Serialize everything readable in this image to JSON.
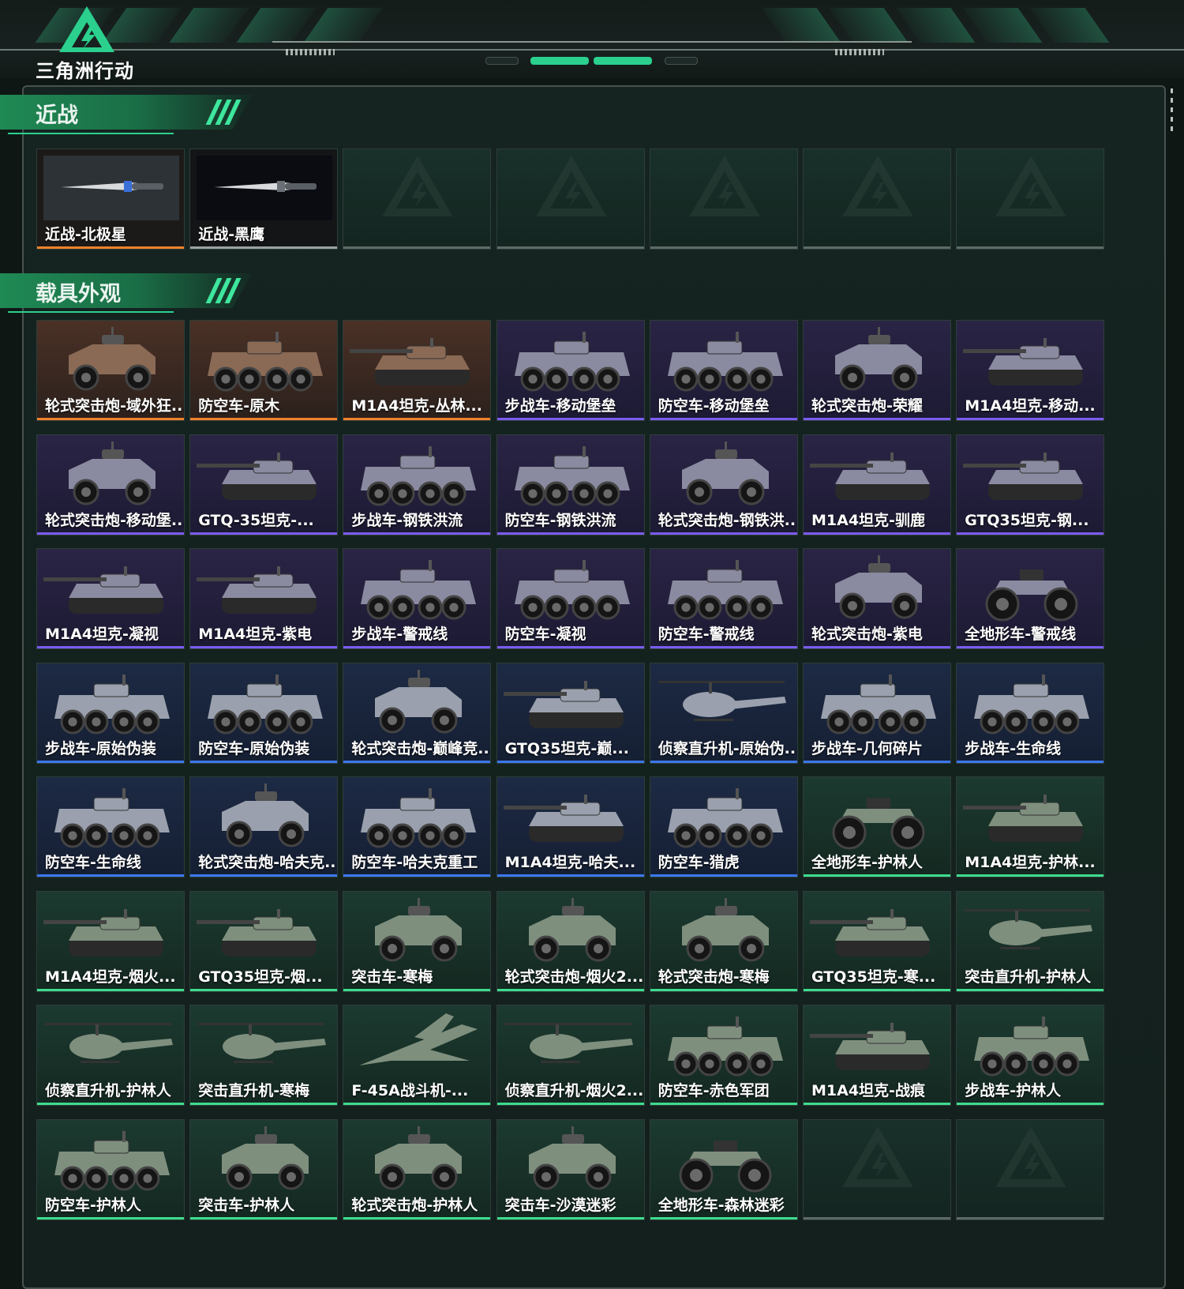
{
  "brand": {
    "name": "三角洲行动",
    "logo_icon": "delta-triangle-logo-icon"
  },
  "colors": {
    "accent": "#2bd08e",
    "orange": "#f0822a",
    "purple": "#7a5cf0",
    "blue": "#3b78f0",
    "green": "#3ddc8e"
  },
  "sections": [
    {
      "title": "近战",
      "items": [
        {
          "label": "近战-北极星",
          "rarity": "orange",
          "type": "knife"
        },
        {
          "label": "近战-黑鹰",
          "rarity": "knife2",
          "type": "knife"
        },
        {
          "label": "",
          "rarity": "empty",
          "type": "empty"
        },
        {
          "label": "",
          "rarity": "empty",
          "type": "empty"
        },
        {
          "label": "",
          "rarity": "empty",
          "type": "empty"
        },
        {
          "label": "",
          "rarity": "empty",
          "type": "empty"
        },
        {
          "label": "",
          "rarity": "empty",
          "type": "empty"
        }
      ]
    },
    {
      "title": "载具外观",
      "items": [
        {
          "label": "轮式突击炮-域外狂...",
          "rarity": "orange",
          "type": "car"
        },
        {
          "label": "防空车-原木",
          "rarity": "orange",
          "type": "apc"
        },
        {
          "label": "M1A4坦克-丛林...",
          "rarity": "orange",
          "type": "tank"
        },
        {
          "label": "步战车-移动堡垒",
          "rarity": "purple",
          "type": "apc"
        },
        {
          "label": "防空车-移动堡垒",
          "rarity": "purple",
          "type": "apc"
        },
        {
          "label": "轮式突击炮-荣耀",
          "rarity": "purple",
          "type": "car"
        },
        {
          "label": "M1A4坦克-移动...",
          "rarity": "purple",
          "type": "tank"
        },
        {
          "label": "轮式突击炮-移动堡...",
          "rarity": "purple",
          "type": "car"
        },
        {
          "label": "GTQ-35坦克-...",
          "rarity": "purple",
          "type": "tank"
        },
        {
          "label": "步战车-钢铁洪流",
          "rarity": "purple",
          "type": "apc"
        },
        {
          "label": "防空车-钢铁洪流",
          "rarity": "purple",
          "type": "apc"
        },
        {
          "label": "轮式突击炮-钢铁洪...",
          "rarity": "purple",
          "type": "car"
        },
        {
          "label": "M1A4坦克-驯鹿",
          "rarity": "purple",
          "type": "tank"
        },
        {
          "label": "GTQ35坦克-钢...",
          "rarity": "purple",
          "type": "tank"
        },
        {
          "label": "M1A4坦克-凝视",
          "rarity": "purple",
          "type": "tank"
        },
        {
          "label": "M1A4坦克-紫电",
          "rarity": "purple",
          "type": "tank"
        },
        {
          "label": "步战车-警戒线",
          "rarity": "purple",
          "type": "apc"
        },
        {
          "label": "防空车-凝视",
          "rarity": "purple",
          "type": "apc"
        },
        {
          "label": "防空车-警戒线",
          "rarity": "purple",
          "type": "apc"
        },
        {
          "label": "轮式突击炮-紫电",
          "rarity": "purple",
          "type": "car"
        },
        {
          "label": "全地形车-警戒线",
          "rarity": "purple",
          "type": "atv"
        },
        {
          "label": "步战车-原始伪装",
          "rarity": "blue",
          "type": "apc"
        },
        {
          "label": "防空车-原始伪装",
          "rarity": "blue",
          "type": "apc"
        },
        {
          "label": "轮式突击炮-巅峰竞...",
          "rarity": "blue",
          "type": "car"
        },
        {
          "label": "GTQ35坦克-巅...",
          "rarity": "blue",
          "type": "tank"
        },
        {
          "label": "侦察直升机-原始伪...",
          "rarity": "blue",
          "type": "heli"
        },
        {
          "label": "步战车-几何碎片",
          "rarity": "blue",
          "type": "apc"
        },
        {
          "label": "步战车-生命线",
          "rarity": "blue",
          "type": "apc"
        },
        {
          "label": "防空车-生命线",
          "rarity": "blue",
          "type": "apc"
        },
        {
          "label": "轮式突击炮-哈夫克...",
          "rarity": "blue",
          "type": "car"
        },
        {
          "label": "防空车-哈夫克重工",
          "rarity": "blue",
          "type": "apc"
        },
        {
          "label": "M1A4坦克-哈夫...",
          "rarity": "blue",
          "type": "tank"
        },
        {
          "label": "防空车-猎虎",
          "rarity": "blue",
          "type": "apc"
        },
        {
          "label": "全地形车-护林人",
          "rarity": "green",
          "type": "atv"
        },
        {
          "label": "M1A4坦克-护林...",
          "rarity": "green",
          "type": "tank"
        },
        {
          "label": "M1A4坦克-烟火...",
          "rarity": "green",
          "type": "tank"
        },
        {
          "label": "GTQ35坦克-烟...",
          "rarity": "green",
          "type": "tank"
        },
        {
          "label": "突击车-寒梅",
          "rarity": "green",
          "type": "car"
        },
        {
          "label": "轮式突击炮-烟火2...",
          "rarity": "green",
          "type": "car"
        },
        {
          "label": "轮式突击炮-寒梅",
          "rarity": "green",
          "type": "car"
        },
        {
          "label": "GTQ35坦克-寒...",
          "rarity": "green",
          "type": "tank"
        },
        {
          "label": "突击直升机-护林人",
          "rarity": "green",
          "type": "heli"
        },
        {
          "label": "侦察直升机-护林人",
          "rarity": "green",
          "type": "heli"
        },
        {
          "label": "突击直升机-寒梅",
          "rarity": "green",
          "type": "heli"
        },
        {
          "label": "F-45A战斗机-...",
          "rarity": "green",
          "type": "jet"
        },
        {
          "label": "侦察直升机-烟火2...",
          "rarity": "green",
          "type": "heli"
        },
        {
          "label": "防空车-赤色军团",
          "rarity": "green",
          "type": "apc"
        },
        {
          "label": "M1A4坦克-战痕",
          "rarity": "green",
          "type": "tank"
        },
        {
          "label": "步战车-护林人",
          "rarity": "green",
          "type": "apc"
        },
        {
          "label": "防空车-护林人",
          "rarity": "green",
          "type": "apc"
        },
        {
          "label": "突击车-护林人",
          "rarity": "green",
          "type": "car"
        },
        {
          "label": "轮式突击炮-护林人",
          "rarity": "green",
          "type": "car"
        },
        {
          "label": "突击车-沙漠迷彩",
          "rarity": "green",
          "type": "car"
        },
        {
          "label": "全地形车-森林迷彩",
          "rarity": "green",
          "type": "atv"
        },
        {
          "label": "",
          "rarity": "empty",
          "type": "empty"
        },
        {
          "label": "",
          "rarity": "empty",
          "type": "empty"
        }
      ]
    }
  ]
}
